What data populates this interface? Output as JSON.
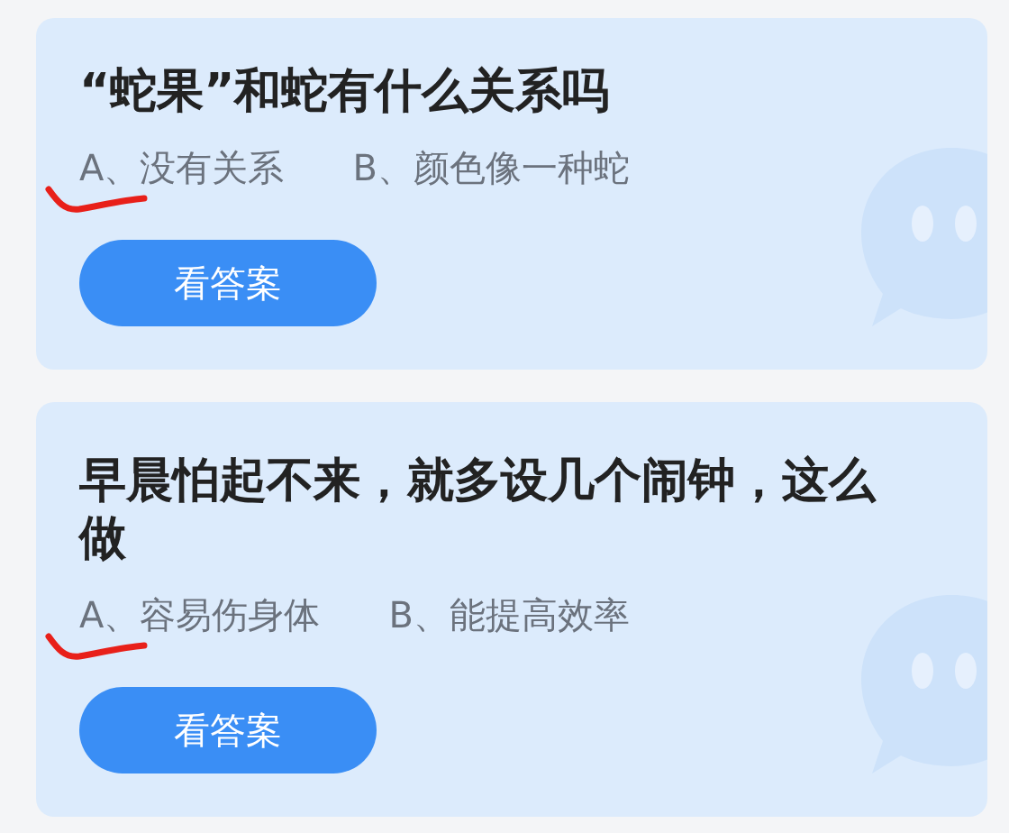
{
  "cards": [
    {
      "question": "“蛇果”和蛇有什么关系吗",
      "options": [
        {
          "text": "A、没有关系",
          "underlined": true
        },
        {
          "text": "B、颜色像一种蛇",
          "underlined": false
        }
      ],
      "button": "看答案"
    },
    {
      "question": "早晨怕起不来，就多设几个闹钟，这么做",
      "options": [
        {
          "text": "A、容易伤身体",
          "underlined": true
        },
        {
          "text": "B、能提高效率",
          "underlined": false
        }
      ],
      "button": "看答案"
    }
  ]
}
